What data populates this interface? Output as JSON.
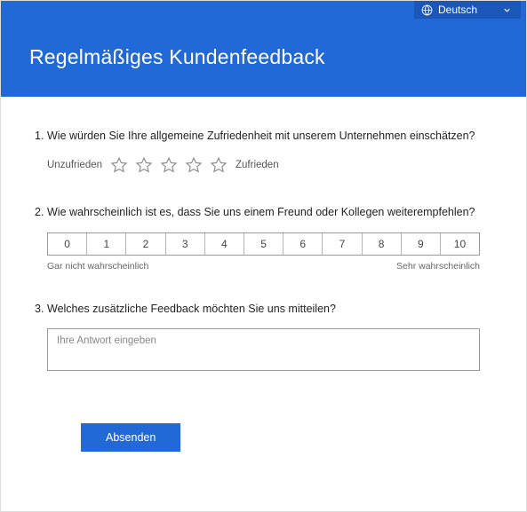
{
  "language": {
    "label": "Deutsch"
  },
  "title": "Regelmäßiges Kundenfeedback",
  "q1": {
    "num": "1.",
    "text": "Wie würden Sie Ihre allgemeine Zufriedenheit mit unserem Unternehmen einschätzen?",
    "low": "Unzufrieden",
    "high": "Zufrieden"
  },
  "q2": {
    "num": "2.",
    "text": "Wie wahrscheinlich ist es, dass Sie uns einem Freund oder Kollegen weiterempfehlen?",
    "scale": [
      "0",
      "1",
      "2",
      "3",
      "4",
      "5",
      "6",
      "7",
      "8",
      "9",
      "10"
    ],
    "low": "Gar nicht wahrscheinlich",
    "high": "Sehr wahrscheinlich"
  },
  "q3": {
    "num": "3.",
    "text": "Welches zusätzliche Feedback möchten Sie uns mitteilen?",
    "placeholder": "Ihre Antwort eingeben"
  },
  "submit": "Absenden"
}
